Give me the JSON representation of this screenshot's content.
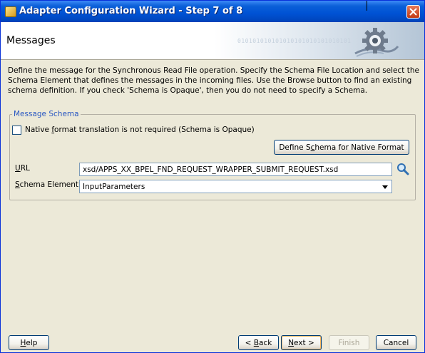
{
  "window": {
    "title": "Adapter Configuration Wizard - Step 7 of 8"
  },
  "header": {
    "title": "Messages",
    "banner_binary": "010101010101010101010101010101"
  },
  "description": "Define the message for the Synchronous Read File operation.  Specify the Schema File Location and select the Schema Element that defines the messages in the incoming files. Use the Browse button to find an existing schema definition. If you check 'Schema is Opaque', then you do not need to specify a Schema.",
  "message_schema": {
    "legend": "Message Schema",
    "checkbox_label_pre": "Native ",
    "checkbox_label_mnemonic": "f",
    "checkbox_label_post": "ormat translation is not required (Schema is Opaque)",
    "checked": false,
    "define_button_pre": "Define S",
    "define_button_mnemonic": "c",
    "define_button_post": "hema for Native Format",
    "url_label_mnemonic": "U",
    "url_label_post": "RL",
    "url_value": "xsd/APPS_XX_BPEL_FND_REQUEST_WRAPPER_SUBMIT_REQUEST.xsd",
    "schema_element_label_mnemonic": "S",
    "schema_element_label_post": "chema Element",
    "schema_element_value": "InputParameters"
  },
  "footer": {
    "help_mnemonic": "H",
    "help_post": "elp",
    "back_pre": "< ",
    "back_mnemonic": "B",
    "back_post": "ack",
    "next_mnemonic": "N",
    "next_post": "ext >",
    "finish": "Finish",
    "cancel": "Cancel"
  },
  "colors": {
    "title_bar": "#0052d4",
    "legend_text": "#2a58c2",
    "dialog_bg": "#ece9d8"
  }
}
